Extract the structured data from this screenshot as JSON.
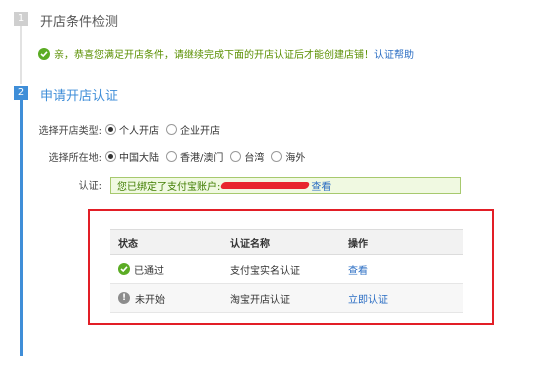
{
  "steps": [
    {
      "number": "1",
      "title": "开店条件检测"
    },
    {
      "number": "2",
      "title": "申请开店认证"
    }
  ],
  "condition_check": {
    "message": "亲，恭喜您满足开店条件，请继续完成下面的开店认证后才能创建店铺！",
    "help_link": "认证帮助"
  },
  "form": {
    "shop_type": {
      "label": "选择开店类型:",
      "options": [
        {
          "label": "个人开店",
          "selected": true
        },
        {
          "label": "企业开店",
          "selected": false
        }
      ]
    },
    "location": {
      "label": "选择所在地:",
      "options": [
        {
          "label": "中国大陆",
          "selected": true
        },
        {
          "label": "香港/澳门",
          "selected": false
        },
        {
          "label": "台湾",
          "selected": false
        },
        {
          "label": "海外",
          "selected": false
        }
      ]
    },
    "verification": {
      "label": "认证:",
      "bound_text": "您已绑定了支付宝账户:",
      "view_link": "查看"
    }
  },
  "status_table": {
    "headers": [
      "状态",
      "认证名称",
      "操作"
    ],
    "rows": [
      {
        "status": "已通过",
        "status_icon": "check-circle-icon",
        "name": "支付宝实名认证",
        "action": "查看"
      },
      {
        "status": "未开始",
        "status_icon": "info-circle-icon",
        "name": "淘宝开店认证",
        "action": "立即认证"
      }
    ]
  },
  "colors": {
    "accent_blue": "#3f8ed8",
    "success_green": "#5bac24",
    "highlight_red": "#e21e26",
    "link_blue": "#2a6dc3"
  }
}
